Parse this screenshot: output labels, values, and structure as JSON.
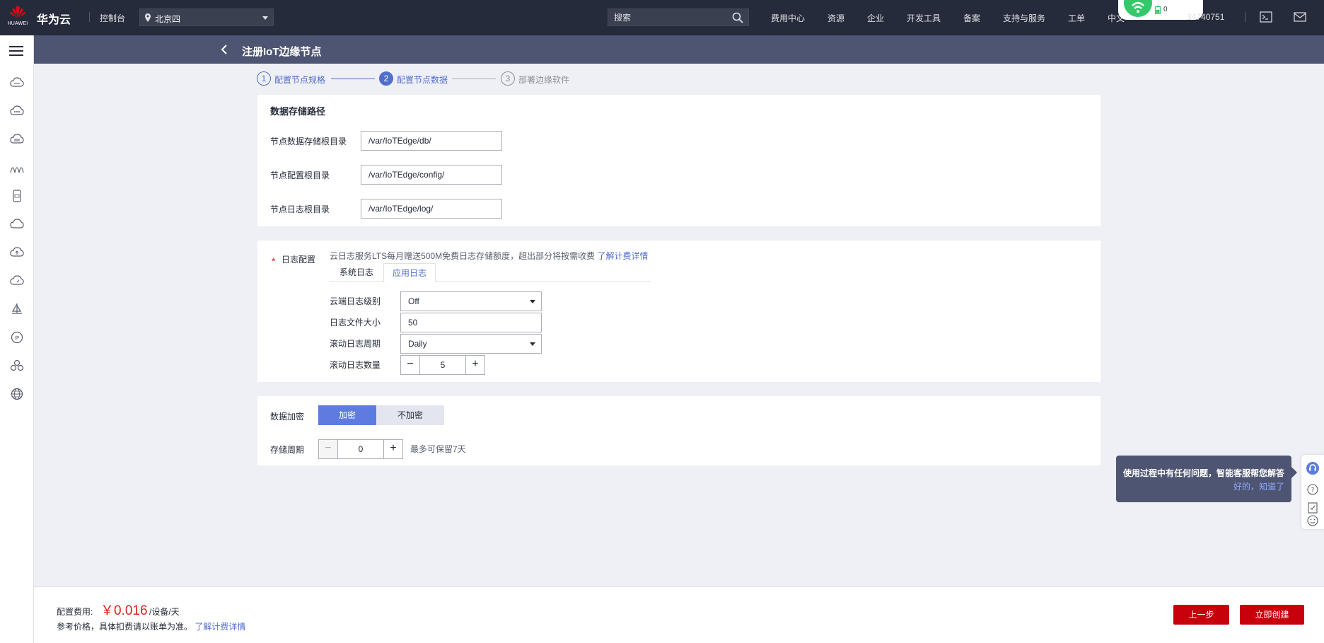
{
  "topbar": {
    "logo_text": "HUAWEI",
    "brand": "华为云",
    "console": "控制台",
    "region": "北京四",
    "search_placeholder": "搜索",
    "nav": [
      "费用中心",
      "资源",
      "企业",
      "开发工具",
      "备案",
      "支持与服务",
      "工单",
      "中文"
    ],
    "account": "34740751",
    "wifi_count": "0",
    "icons": [
      "location-pin-icon",
      "search-icon",
      "terminal-icon",
      "mail-icon",
      "wifi-icon",
      "battery-icon"
    ]
  },
  "sidebar": {
    "icons": [
      "menu-icon",
      "cloud-server-icon",
      "cloud-network-icon",
      "cloud-storage-icon",
      "iot-bridge-icon",
      "device-icon",
      "cloud-icon",
      "cloud-upload-icon",
      "cloud-speed-icon",
      "sailboat-icon",
      "ip-icon",
      "cluster-icon",
      "globe-icon"
    ]
  },
  "header": {
    "title": "注册IoT边缘节点"
  },
  "steps": [
    {
      "num": "1",
      "label": "配置节点规格",
      "state": "done"
    },
    {
      "num": "2",
      "label": "配置节点数据",
      "state": "active"
    },
    {
      "num": "3",
      "label": "部署边缘软件",
      "state": "pending"
    }
  ],
  "storage": {
    "title": "数据存储路径",
    "fields": [
      {
        "label": "节点数据存储根目录",
        "value": "/var/IoTEdge/db/"
      },
      {
        "label": "节点配置根目录",
        "value": "/var/IoTEdge/config/"
      },
      {
        "label": "节点日志根目录",
        "value": "/var/IoTEdge/log/"
      }
    ]
  },
  "log": {
    "required_mark": "*",
    "label": "日志配置",
    "note": "云日志服务LTS每月赠送500M免费日志存储额度，超出部分将按需收费",
    "note_link": "了解计费详情",
    "tabs": [
      "系统日志",
      "应用日志"
    ],
    "active_tab": 1,
    "level_label": "云端日志级别",
    "level_value": "Off",
    "size_label": "日志文件大小",
    "size_value": "50",
    "period_label": "滚动日志周期",
    "period_value": "Daily",
    "count_label": "滚动日志数量",
    "count_value": "5"
  },
  "encrypt": {
    "label": "数据加密",
    "options": [
      "加密",
      "不加密"
    ],
    "selected": 0,
    "retention_label": "存储周期",
    "retention_value": "0",
    "retention_note": "最多可保留7天"
  },
  "footer": {
    "fee_label": "配置费用:",
    "fee_amount": "￥0.016",
    "fee_unit": "/设备/天",
    "fee_note": "参考价格，具体扣费请以账单为准。",
    "fee_link": "了解计费详情",
    "prev_button": "上一步",
    "create_button": "立即创建"
  },
  "helper": {
    "message": "使用过程中有任何问题，智能客服帮您解答",
    "dismiss": "好的，知道了",
    "icons": [
      "customer-service-icon",
      "help-icon",
      "feedback-icon",
      "smile-icon"
    ]
  },
  "colors": {
    "topbar": "#252b3a",
    "subheader": "#4e5572",
    "accent": "#526ecc",
    "danger": "#c7000b",
    "price": "#e02020"
  }
}
